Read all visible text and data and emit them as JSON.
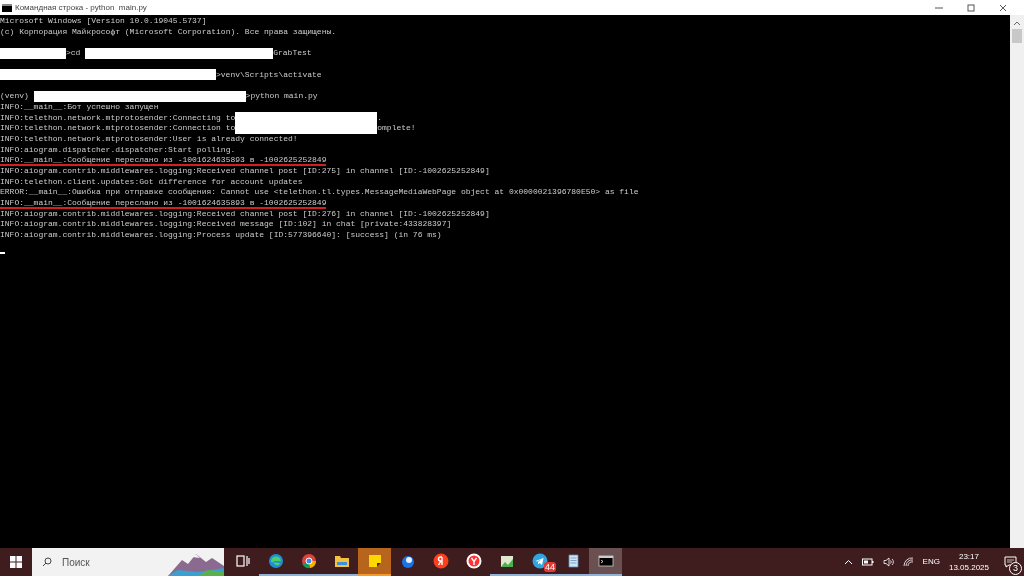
{
  "window": {
    "title": "Командная строка - python  main.py"
  },
  "console": {
    "lines": [
      {
        "segments": [
          {
            "text": "Microsoft Windows [Version 10.0.19045.5737]"
          }
        ]
      },
      {
        "segments": [
          {
            "text": "(c) Корпорация Майкрософт (Microsoft Corporation). Все права защищены."
          }
        ]
      },
      {
        "kind": "prompt",
        "segments": [
          {
            "kind": "redacted"
          },
          {
            "text": ">cd "
          },
          {
            "kind": "redacted"
          },
          {
            "text": "GrabTest"
          }
        ]
      },
      {
        "kind": "prompt",
        "segments": [
          {
            "kind": "redacted"
          },
          {
            "text": ">venv\\Scripts\\activate"
          }
        ]
      },
      {
        "kind": "prompt",
        "segments": [
          {
            "text": "(venv) "
          },
          {
            "kind": "redacted"
          },
          {
            "text": ">python main.py"
          }
        ]
      },
      {
        "segments": [
          {
            "text": "INFO:__main__:Бот успешно запущен"
          }
        ]
      },
      {
        "segments": [
          {
            "text": "INFO:telethon.network.mtprotosender:Connecting to"
          },
          {
            "kind": "redacted"
          },
          {
            "text": "."
          }
        ]
      },
      {
        "segments": [
          {
            "text": "INFO:telethon.network.mtprotosender:Connection to"
          },
          {
            "kind": "redacted"
          },
          {
            "text": "omplete!"
          }
        ]
      },
      {
        "segments": [
          {
            "text": "INFO:telethon.network.mtprotosender:User is already connected!"
          }
        ]
      },
      {
        "segments": [
          {
            "text": "INFO:aiogram.dispatcher.dispatcher:Start polling."
          }
        ]
      },
      {
        "underline": true,
        "segments": [
          {
            "text": "INFO:__main__:Сообщение переслано из -1001624635893 в -1002625252849"
          }
        ]
      },
      {
        "segments": [
          {
            "text": "INFO:aiogram.contrib.middlewares.logging:Received channel post [ID:275] in channel [ID:-1002625252849]"
          }
        ]
      },
      {
        "segments": [
          {
            "text": "INFO:telethon.client.updates:Got difference for account updates"
          }
        ]
      },
      {
        "segments": [
          {
            "text": "ERROR:__main__:Ошибка при отправке сообщения: Cannot use <telethon.tl.types.MessageMediaWebPage object at 0x0000021396780E50> as file"
          }
        ]
      },
      {
        "underline": true,
        "segments": [
          {
            "text": "INFO:__main__:Сообщение переслано из -1001624635893 в -1002625252849"
          }
        ]
      },
      {
        "segments": [
          {
            "text": "INFO:aiogram.contrib.middlewares.logging:Received channel post [ID:276] in channel [ID:-1002625252849]"
          }
        ]
      },
      {
        "segments": [
          {
            "text": "INFO:aiogram.contrib.middlewares.logging:Received message [ID:102] in chat [private:433828397]"
          }
        ]
      },
      {
        "segments": [
          {
            "text": "INFO:aiogram.contrib.middlewares.logging:Process update [ID:577396640]: [success] (in 76 ms)"
          }
        ]
      }
    ]
  },
  "taskbar": {
    "search": {
      "placeholder": "Поиск"
    },
    "apps": [
      {
        "kind": "taskview",
        "running": false,
        "selected": false,
        "flashing": false
      },
      {
        "kind": "edge",
        "running": true,
        "selected": false,
        "flashing": false
      },
      {
        "kind": "chrome",
        "running": true,
        "selected": false,
        "flashing": false
      },
      {
        "kind": "folder",
        "running": true,
        "selected": false,
        "flashing": false
      },
      {
        "kind": "notes",
        "running": true,
        "selected": false,
        "flashing": true
      },
      {
        "kind": "bird",
        "running": false,
        "selected": false,
        "flashing": false
      },
      {
        "kind": "yandex",
        "running": false,
        "selected": false,
        "flashing": false
      },
      {
        "kind": "ybrowser",
        "running": false,
        "selected": false,
        "flashing": false
      },
      {
        "kind": "chart",
        "running": true,
        "selected": false,
        "flashing": false
      },
      {
        "kind": "telegram",
        "running": true,
        "selected": false,
        "flashing": false,
        "badge": "44"
      },
      {
        "kind": "notepad",
        "running": true,
        "selected": false,
        "flashing": false
      },
      {
        "kind": "terminal",
        "running": true,
        "selected": true,
        "flashing": false
      }
    ],
    "tray": {
      "language": "ENG",
      "time": "23:17",
      "date": "13.05.2025",
      "notifications": "3"
    }
  }
}
